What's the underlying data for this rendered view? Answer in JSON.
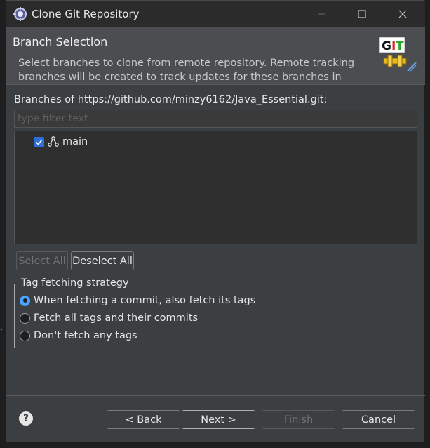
{
  "window": {
    "title": "Clone Git Repository"
  },
  "header": {
    "title": "Branch Selection",
    "description": "Select branches to clone from remote repository. Remote tracking branches will be created to track updates for these branches in the"
  },
  "branches": {
    "label": "Branches of https://github.com/minzy6162/Java_Essential.git:",
    "filter_placeholder": "type filter text",
    "filter_value": "",
    "items": [
      {
        "name": "main",
        "checked": true
      }
    ],
    "select_all_label": "Select All",
    "deselect_all_label": "Deselect All"
  },
  "tag_strategy": {
    "title": "Tag fetching strategy",
    "options": [
      {
        "label": "When fetching a commit, also fetch its tags",
        "selected": true
      },
      {
        "label": "Fetch all tags and their commits",
        "selected": false
      },
      {
        "label": "Don't fetch any tags",
        "selected": false
      }
    ]
  },
  "footer": {
    "help_label": "?",
    "back_label": "< Back",
    "next_label": "Next >",
    "finish_label": "Finish",
    "cancel_label": "Cancel"
  },
  "colors": {
    "accent": "#2d6fd6",
    "radio_selected": "#4aa3ff",
    "dialog_bg": "#3c3f41",
    "titlebar_bg": "#2b2b2b"
  },
  "icons": {
    "app": "eclipse-gear-icon",
    "git": "git-logo-icon",
    "branch": "branch-icon",
    "checkbox": "check-icon",
    "help": "help-icon"
  }
}
